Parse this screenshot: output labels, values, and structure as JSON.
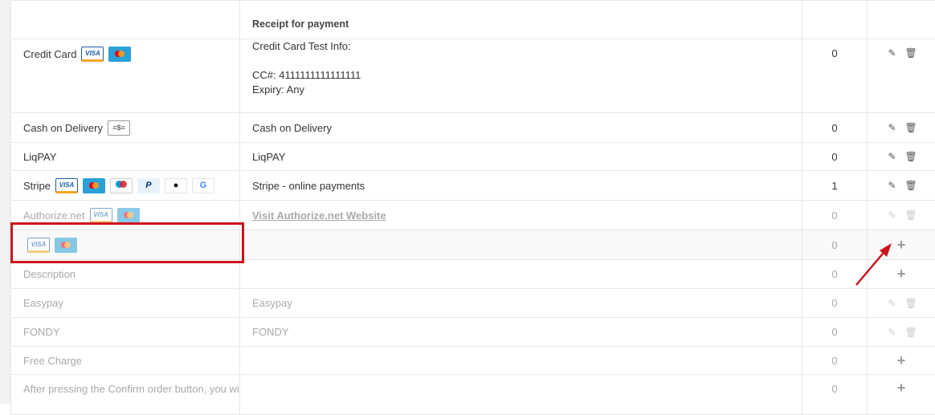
{
  "header": {
    "description_label": "Receipt for payment"
  },
  "rows": [
    {
      "name": "Credit Card",
      "description_lines": [
        "Credit Card Test Info:",
        "",
        "CC#: 4111111111111111",
        "Expiry: Any"
      ],
      "count": "0"
    },
    {
      "name": "Cash on Delivery",
      "description": "Cash on Delivery",
      "count": "0"
    },
    {
      "name": "LiqPAY",
      "description": "LiqPAY",
      "count": "0"
    },
    {
      "name": "Stripe",
      "description": "Stripe - online payments",
      "count": "1"
    },
    {
      "name": "Authorize.net",
      "description": "Visit Authorize.net Website",
      "count": "0"
    },
    {
      "name": "",
      "description": "",
      "count": "0"
    },
    {
      "name": "Description",
      "description": "",
      "count": "0"
    },
    {
      "name": "Easypay",
      "description": "Easypay",
      "count": "0"
    },
    {
      "name": "FONDY",
      "description": "FONDY",
      "count": "0"
    },
    {
      "name": "Free Charge",
      "description": "",
      "count": "0"
    },
    {
      "name": "After pressing the Confirm order button, you will be redirected to the payment system",
      "description": "",
      "count": "0"
    }
  ],
  "icons": {
    "visa": "VISA",
    "paypal": "P",
    "apple": "",
    "google": "G",
    "cash": "≡$≡"
  },
  "colors": {
    "highlight": "#d0121b",
    "arrow": "#d0121b"
  }
}
